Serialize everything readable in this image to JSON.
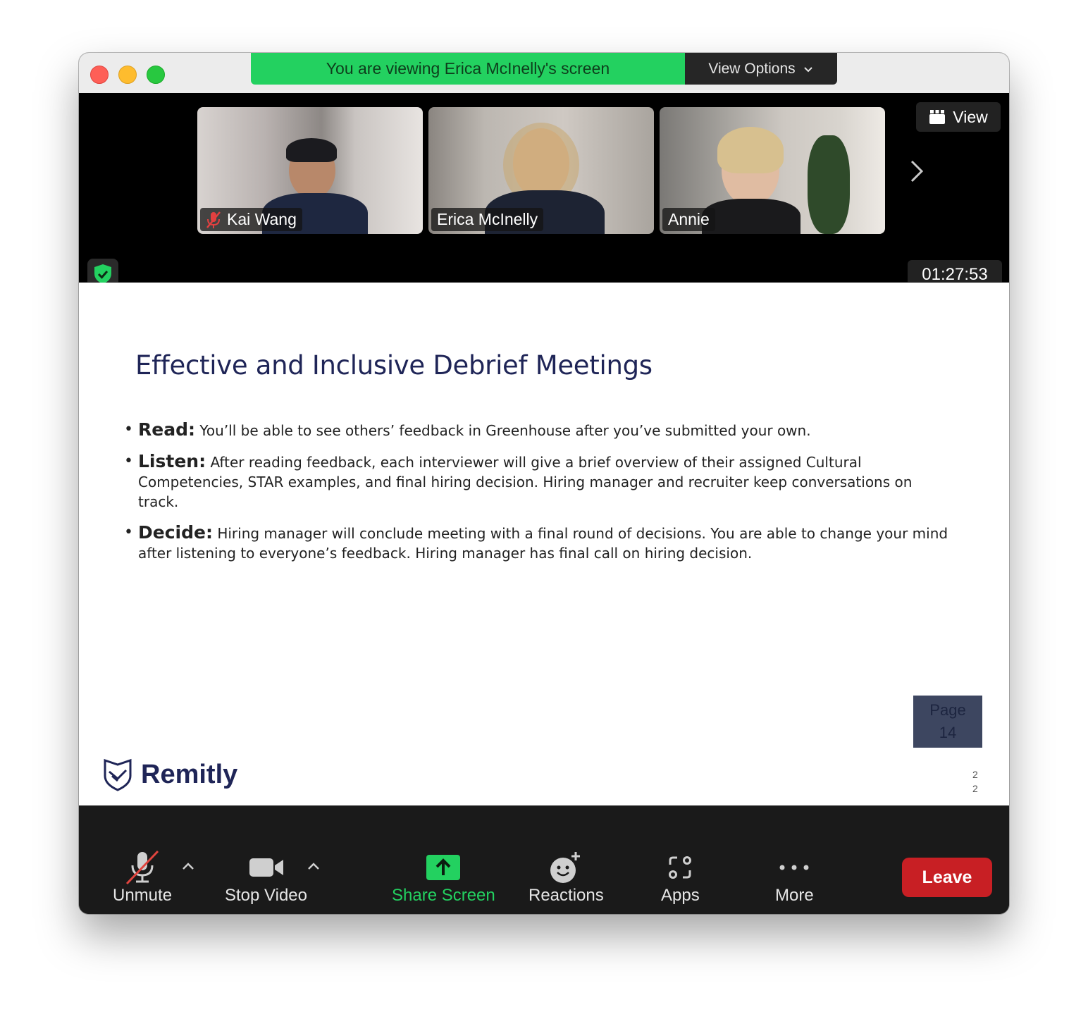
{
  "banner": {
    "text": "You are viewing Erica McInelly's screen",
    "options_label": "View Options"
  },
  "gallery": {
    "view_label": "View",
    "participants": [
      {
        "name": "Kai Wang",
        "muted": true
      },
      {
        "name": "Erica McInelly",
        "muted": false
      },
      {
        "name": "Annie",
        "muted": false
      }
    ]
  },
  "meeting": {
    "timer": "01:27:53"
  },
  "slide": {
    "title": "Effective and Inclusive Debrief Meetings",
    "bullets": [
      {
        "label": "Read:",
        "text": "You’ll be able to see others’ feedback in Greenhouse after you’ve submitted your own."
      },
      {
        "label": "Listen:",
        "text": "After reading feedback, each interviewer will give a brief overview of their assigned Cultural Competencies, STAR examples, and final hiring decision. Hiring manager and recruiter keep conversations on track."
      },
      {
        "label": "Decide:",
        "text": "Hiring manager will conclude meeting with a final round of decisions. You are able to change your mind after listening to everyone’s feedback. Hiring manager has final call on hiring decision."
      }
    ],
    "page_box": {
      "line1": "Page",
      "line2": "14"
    },
    "logo_text": "Remitly",
    "slide_number": {
      "line1": "2",
      "line2": "2"
    }
  },
  "toolbar": {
    "unmute": "Unmute",
    "stop_video": "Stop Video",
    "share_screen": "Share Screen",
    "reactions": "Reactions",
    "apps": "Apps",
    "more": "More",
    "leave": "Leave"
  },
  "colors": {
    "share_green": "#23d160",
    "leave_red": "#c81f24",
    "title_navy": "#1f2557"
  }
}
